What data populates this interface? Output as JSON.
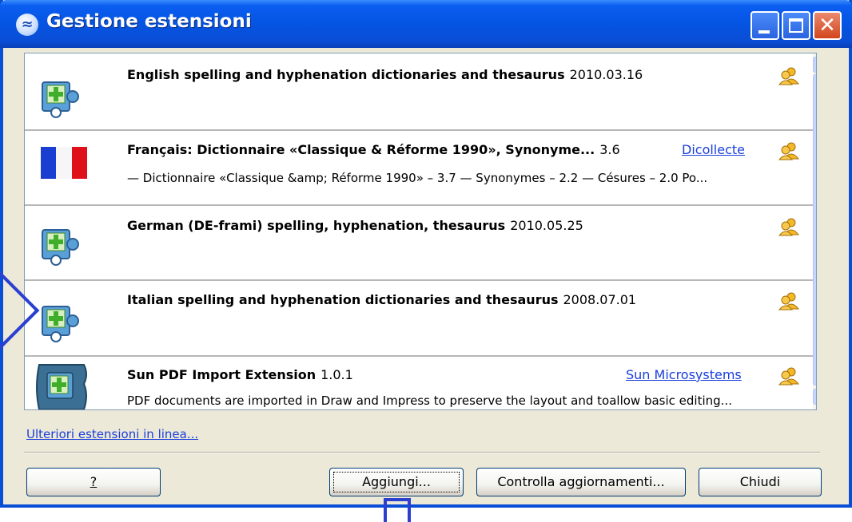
{
  "window": {
    "title": "Gestione estensioni"
  },
  "extensions": [
    {
      "icon": "puzzle-icon",
      "name": "English spelling and hyphenation dictionaries and thesaurus",
      "version": "2010.03.16",
      "publisher": "",
      "description": ""
    },
    {
      "icon": "french-flag-icon",
      "name": "Français: Dictionnaire «Classique & Réforme 1990», Synonyme...",
      "version": "3.6",
      "publisher": "Dicollecte",
      "description": "— Dictionnaire «Classique &amp; Réforme 1990» – 3.7  — Synonymes – 2.2  — Césures – 2.0  Po..."
    },
    {
      "icon": "puzzle-icon",
      "name": "German (DE-frami) spelling, hyphenation, thesaurus",
      "version": "2010.05.25",
      "publisher": "",
      "description": ""
    },
    {
      "icon": "puzzle-icon",
      "name": "Italian spelling and hyphenation dictionaries and thesaurus",
      "version": "2008.07.01",
      "publisher": "",
      "description": ""
    },
    {
      "icon": "pdf-puzzle-icon",
      "name": "Sun PDF Import Extension",
      "version": "1.0.1",
      "publisher": "Sun Microsystems",
      "description": "PDF documents are imported in Draw and Impress to preserve the layout and toallow basic editing..."
    }
  ],
  "more_link": "Ulteriori estensioni in linea...",
  "buttons": {
    "help": "?",
    "add": "Aggiungi...",
    "check_updates": "Controlla aggiornamenti...",
    "close": "Chiudi"
  },
  "colors": {
    "title_bar": "#0a4ed6",
    "link": "#1a3edc",
    "dialog_bg": "#ece9d8",
    "callout": "#2b3fd0"
  }
}
